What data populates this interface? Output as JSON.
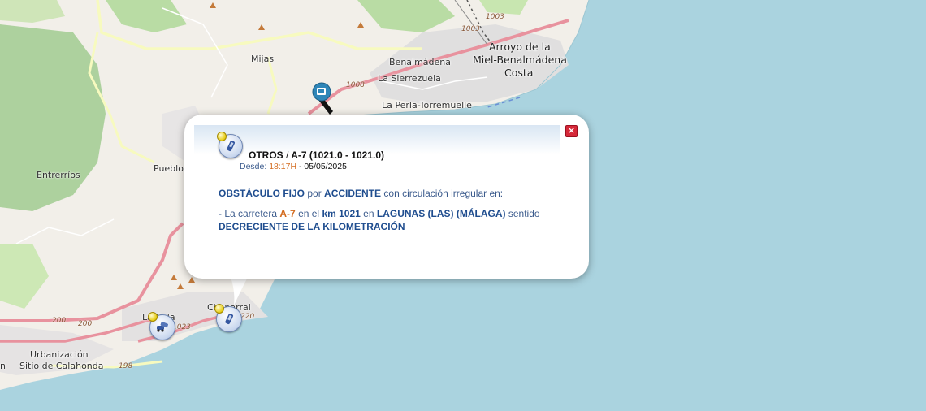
{
  "map": {
    "places": [
      {
        "name": "Mijas"
      },
      {
        "name": "Benalmádena"
      },
      {
        "name": "La Sierrezuela"
      },
      {
        "name": "La Perla-Torremuelle"
      },
      {
        "name": "Arroyo de la"
      },
      {
        "name": "Miel-Benalmádena"
      },
      {
        "name": "Costa"
      },
      {
        "name": "Entrerríos"
      },
      {
        "name": "Pueblo"
      },
      {
        "name": "Chaparral"
      },
      {
        "name": "La Cala"
      },
      {
        "name": "Urbanización"
      },
      {
        "name": "Sitio de Calahonda"
      },
      {
        "name": "n"
      }
    ],
    "roads": [
      "1003",
      "1003",
      "1008",
      "1023",
      "200",
      "200",
      "198",
      "220"
    ],
    "colors": {
      "sea": "#aad3df",
      "land": "#f2efe9",
      "forest": "#add19e",
      "urban": "#dddddd",
      "primary_road": "#e8929e",
      "secondary_road": "#f7fabf"
    },
    "markers": [
      {
        "type": "accident-marker",
        "icon": "crashed-cars-icon"
      },
      {
        "type": "obstacle-marker",
        "icon": "phone-handset-icon"
      },
      {
        "type": "selected-pin",
        "icon": "pin-icon"
      }
    ]
  },
  "popup": {
    "category": "OTROS",
    "separator": "/",
    "road_ref": "A-7 (1021.0 - 1021.0)",
    "since_label": "Desde:",
    "since_time": "18:17H",
    "since_date": "- 05/05/2025",
    "obstacle": "OBSTÁCULO FIJO",
    "por": "por",
    "cause": "ACCIDENTE",
    "circulation": "con circulación irregular en:",
    "line_prefix": "- La carretera",
    "road": "A-7",
    "en_el": "en el",
    "km": "km 1021",
    "en": "en",
    "location": "LAGUNAS (LAS)",
    "province": "(MÁLAGA)",
    "sentido": "sentido",
    "direction": "DECRECIENTE DE LA KILOMETRACIÓN",
    "close_label": "×"
  }
}
